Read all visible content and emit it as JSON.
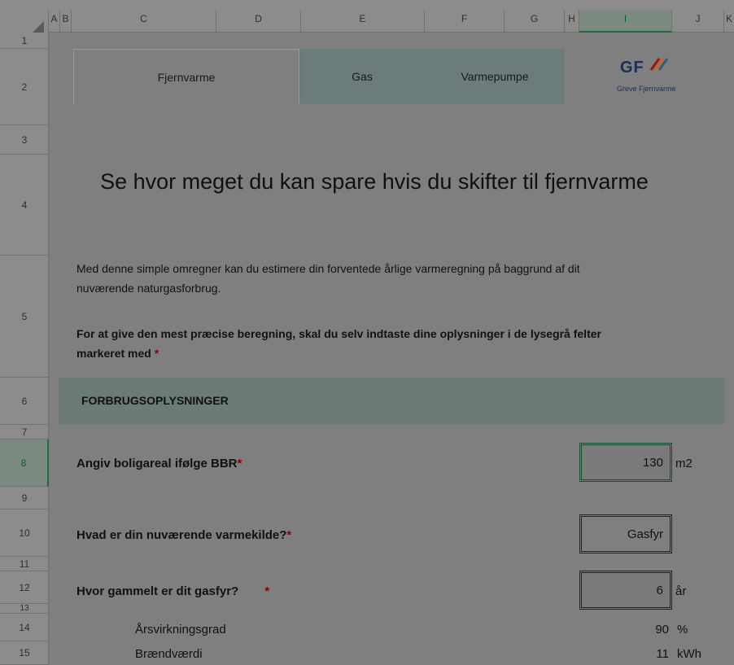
{
  "columns": [
    "A",
    "B",
    "C",
    "D",
    "E",
    "F",
    "G",
    "H",
    "I",
    "J",
    "K"
  ],
  "selected_column": "I",
  "rows": [
    "1",
    "2",
    "3",
    "4",
    "5",
    "6",
    "7",
    "8",
    "9",
    "10",
    "11",
    "12",
    "13",
    "14",
    "15"
  ],
  "selected_row": "8",
  "tabs": [
    {
      "label": "Fjernvarme",
      "active": true
    },
    {
      "label": "Gas",
      "active": false
    },
    {
      "label": "Varmepumpe",
      "active": false
    }
  ],
  "logo": {
    "mark": "GF",
    "name": "Greve Fjernvarme"
  },
  "title": "Se hvor meget du kan spare hvis du skifter til fjernvarme",
  "intro": "Med denne simple omregner kan du estimere din forventede årlige varmeregning på baggrund af dit nuværende naturgasforbrug.",
  "instruction": "For at give den mest præcise beregning, skal du selv indtaste dine oplysninger i de lysegrå felter markeret med",
  "required_mark": "*",
  "section_title": "FORBRUGSOPLYSNINGER",
  "fields": {
    "area": {
      "label": "Angiv boligareal ifølge BBR",
      "value": "130",
      "unit": "m2"
    },
    "source": {
      "label": "Hvad er din nuværende varmekilde?",
      "value": "Gasfyr"
    },
    "age": {
      "label": "Hvor gammelt er dit gasfyr?",
      "value": "6",
      "unit": "år"
    }
  },
  "derived": {
    "efficiency": {
      "label": "Årsvirkningsgrad",
      "value": "90",
      "unit": "%"
    },
    "calorific": {
      "label": "Brændværdi",
      "value": "11",
      "unit": "kWh"
    }
  },
  "colors": {
    "accent_green": "#1c6e3a",
    "required_red": "#8b0000",
    "section_bg": "#6c7a78"
  }
}
